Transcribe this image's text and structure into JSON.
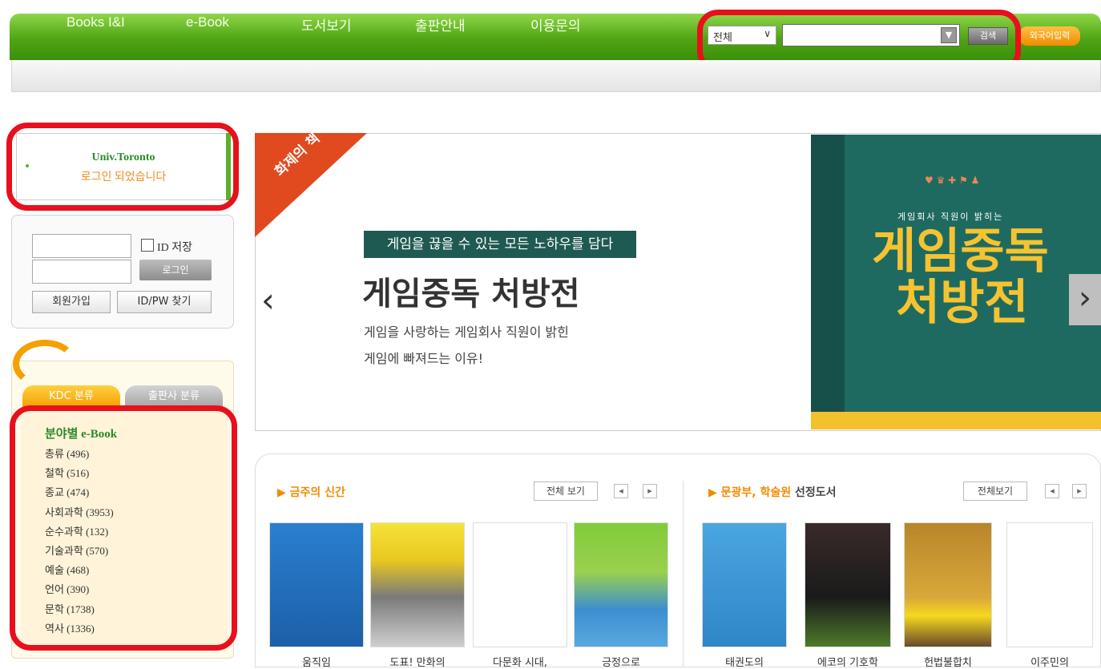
{
  "nav": {
    "items": [
      "Books I&I",
      "e-Book",
      "도서보기",
      "출판안내",
      "이용문의"
    ],
    "search_scope": "전체",
    "search_value": "",
    "search_button": "검색",
    "foreign_input": "외국어입력"
  },
  "login_status": {
    "university": "Univ.Toronto",
    "message": "로그인 되었습니다"
  },
  "login_form": {
    "save_id_label": "ID 저장",
    "login_button": "로그인",
    "join_button": "회원가입",
    "find_button": "ID/PW 찾기"
  },
  "category": {
    "tabs": [
      "KDC 분류",
      "출판사 분류"
    ],
    "title": "분야별 e-Book",
    "items": [
      "총류 (496)",
      "철학 (516)",
      "종교 (474)",
      "사회과학 (3953)",
      "순수과학 (132)",
      "기술과학 (570)",
      "예술 (468)",
      "언어 (390)",
      "문학 (1738)",
      "역사 (1336)"
    ]
  },
  "banner": {
    "ribbon": "화제의 책",
    "tagline": "게임을 끊을 수 있는 모든 노하우를 담다",
    "title": "게임중독 처방전",
    "desc_line1": "게임을 사랑하는 게임회사 직원이 밝힌",
    "desc_line2": "게임에 빠져드는 이유!",
    "cover_subtitle": "게임회사 직원이 밝히는",
    "cover_title1": "게임중독",
    "cover_title2": "처방전",
    "prev": "‹",
    "next": "›"
  },
  "new_books": {
    "title": "금주의 신간",
    "view_all": "전체 보기",
    "books": [
      "움직임",
      "도표! 만화의",
      "다문화 시대,",
      "긍정으로"
    ]
  },
  "selected_books": {
    "title_prefix": "문광부, 학술원",
    "title_suffix": "선정도서",
    "view_all": "전체보기",
    "books": [
      "태권도의",
      "에코의 기호학",
      "헌법불합치",
      "이주민의"
    ]
  },
  "colors": {
    "nav_green": "#4ea513",
    "highlight_red": "#e8101c",
    "accent_orange": "#f08c00",
    "banner_teal": "#1f6a60",
    "cover_yellow": "#f6c330"
  }
}
